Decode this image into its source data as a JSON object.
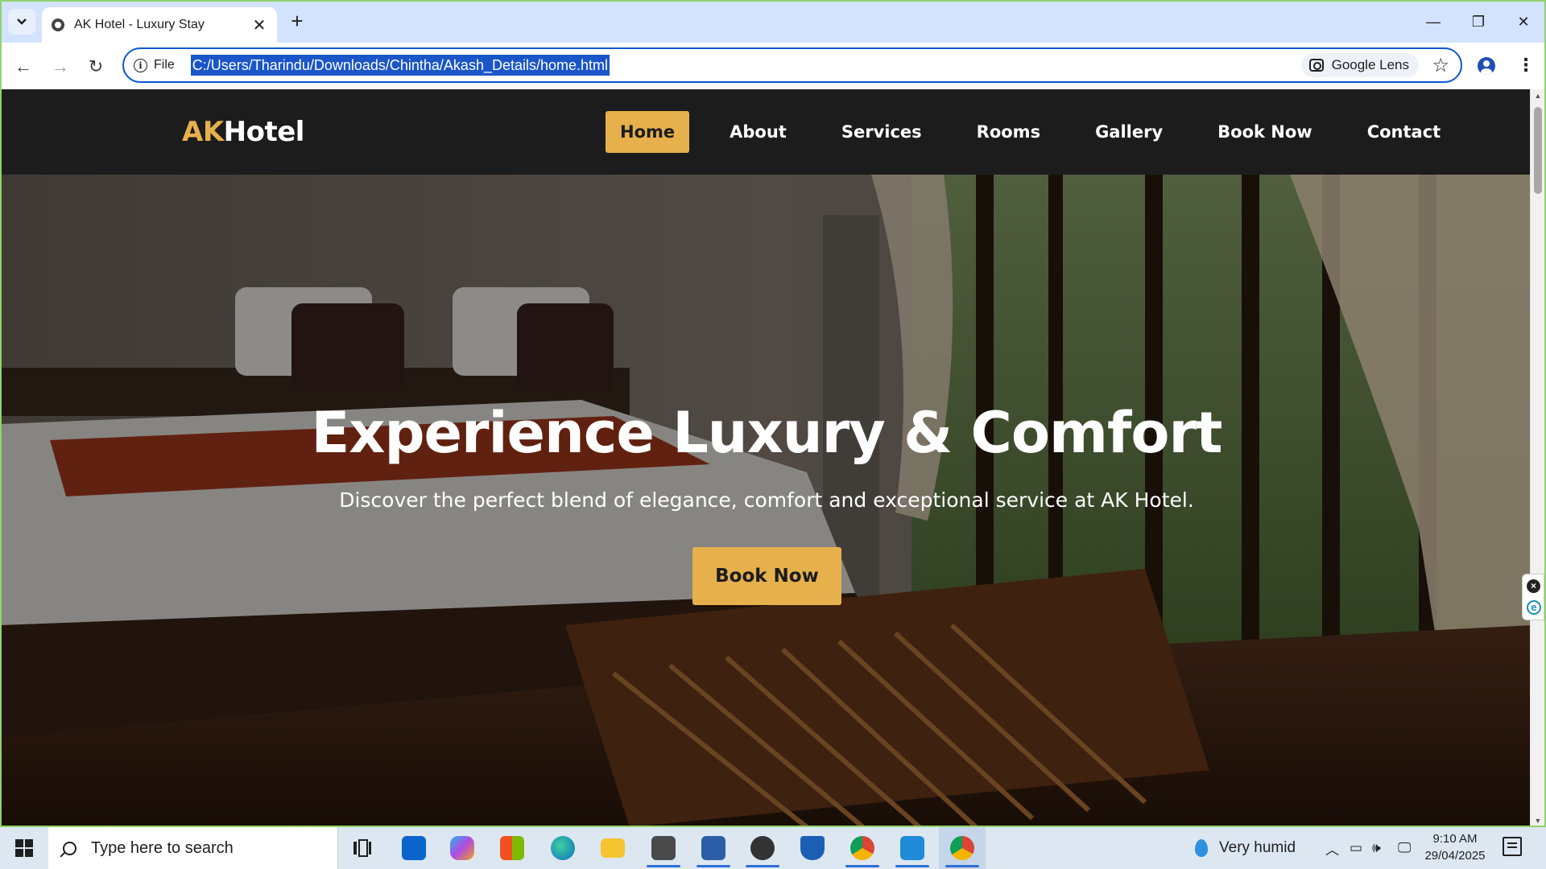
{
  "browser": {
    "tab_title": "AK Hotel - Luxury Stay",
    "tab_close": "✕",
    "new_tab": "+",
    "url_scheme_label": "File",
    "url": "C:/Users/Tharindu/Downloads/Chintha/Akash_Details/home.html",
    "lens_label": "Google Lens",
    "window_controls": {
      "minimize": "—",
      "restore": "❐",
      "close": "✕"
    },
    "nav": {
      "back": "←",
      "forward": "→",
      "reload": "↻"
    }
  },
  "site": {
    "logo_accent": "AK",
    "logo_rest": "Hotel",
    "nav": [
      "Home",
      "About",
      "Services",
      "Rooms",
      "Gallery",
      "Book Now",
      "Contact"
    ],
    "active_nav": "Home",
    "hero": {
      "title": "Experience Luxury & Comfort",
      "subtitle": "Discover the perfect blend of elegance, comfort and exceptional service at AK Hotel.",
      "cta": "Book Now"
    },
    "colors": {
      "accent": "#e6b04c",
      "header_bg": "#1c1c1c"
    }
  },
  "taskbar": {
    "search_placeholder": "Type here to search",
    "weather": "Very humid",
    "time": "9:10 AM",
    "date": "29/04/2025",
    "apps": [
      "task-view",
      "outlook",
      "copilot",
      "store",
      "edge",
      "file-explorer",
      "sublime",
      "remote-desktop",
      "obs",
      "security",
      "chrome",
      "vscode",
      "chrome-active"
    ]
  }
}
